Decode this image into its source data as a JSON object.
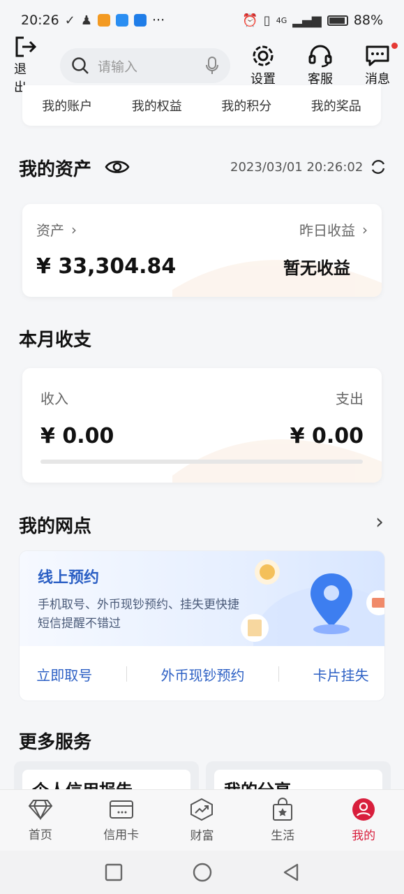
{
  "status_bar": {
    "time": "20:26",
    "battery": "88%",
    "network": "4G",
    "more": "···"
  },
  "topbar": {
    "logout_label": "退出",
    "search_placeholder": "请输入",
    "settings_label": "设置",
    "service_label": "客服",
    "message_label": "消息"
  },
  "quick_links": [
    "我的账户",
    "我的权益",
    "我的积分",
    "我的奖品"
  ],
  "assets": {
    "title": "我的资产",
    "timestamp": "2023/03/01 20:26:02",
    "asset_label": "资产",
    "asset_value": "¥ 33,304.84",
    "yesterday_label": "昨日收益",
    "yesterday_value": "暂无收益"
  },
  "monthly": {
    "title": "本月收支",
    "income_label": "收入",
    "income_value": "¥ 0.00",
    "expense_label": "支出",
    "expense_value": "¥ 0.00"
  },
  "branch": {
    "title": "我的网点",
    "banner_title": "线上预约",
    "banner_line1": "手机取号、外币现钞预约、挂失更快捷",
    "banner_line2": "短信提醒不错过",
    "actions": [
      "立即取号",
      "外币现钞预约",
      "卡片挂失"
    ]
  },
  "more": {
    "title": "更多服务",
    "cards": [
      "个人信用报告",
      "我的分享"
    ]
  },
  "bottom_nav": [
    {
      "label": "首页",
      "icon": "diamond-icon"
    },
    {
      "label": "信用卡",
      "icon": "card-icon"
    },
    {
      "label": "财富",
      "icon": "chart-icon"
    },
    {
      "label": "生活",
      "icon": "shopping-bag-icon"
    },
    {
      "label": "我的",
      "icon": "user-icon"
    }
  ],
  "colors": {
    "accent_red": "#d81e3c",
    "link_blue": "#2b5fc4"
  }
}
